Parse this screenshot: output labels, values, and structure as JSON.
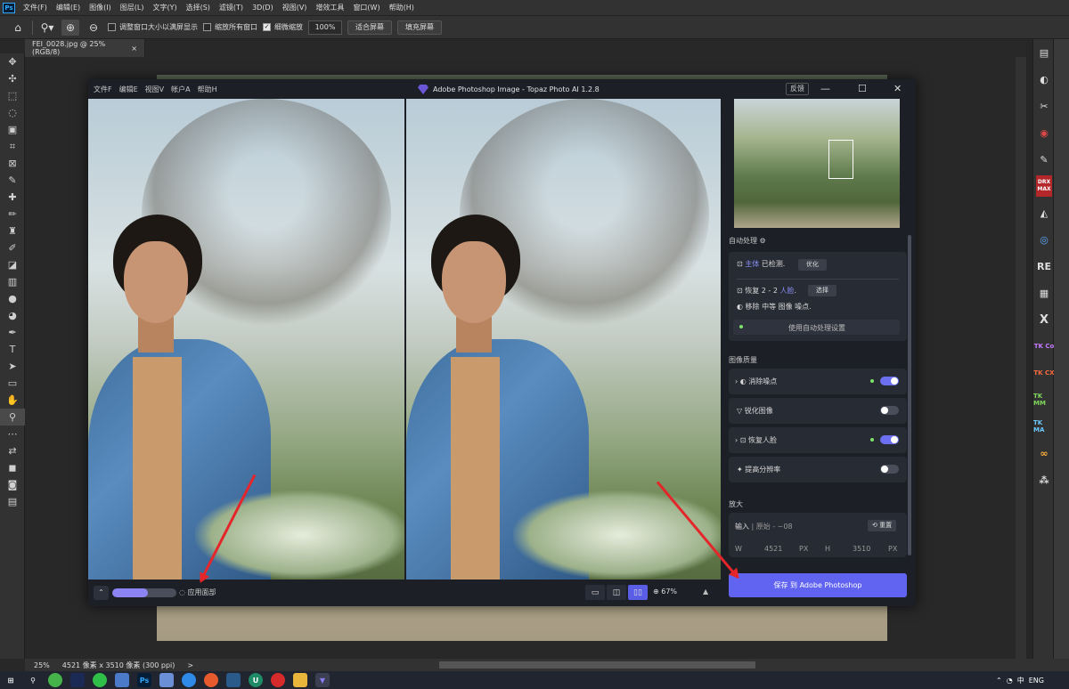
{
  "app_logo": "Ps",
  "menu": [
    "文件(F)",
    "编辑(E)",
    "图像(I)",
    "图层(L)",
    "文字(Y)",
    "选择(S)",
    "滤镜(T)",
    "3D(D)",
    "视图(V)",
    "增效工具",
    "窗口(W)",
    "帮助(H)"
  ],
  "options_bar": {
    "resize_windows": "调整窗口大小以满屏显示",
    "zoom_all_windows": "缩放所有窗口",
    "scrubby_zoom": "细微缩放",
    "zoom_value": "100%",
    "fit_screen": "适合屏幕",
    "fill_screen": "填充屏幕"
  },
  "doc_tab": {
    "title": "FEI_0028.jpg @ 25%(RGB/8)",
    "close": "×"
  },
  "status": {
    "zoom": "25%",
    "doc_info": "4521 像素 x 3510 像素 (300 ppi)",
    "arrow": ">"
  },
  "topaz": {
    "menu": [
      "文件F",
      "编辑E",
      "视图V",
      "帐户A",
      "帮助H"
    ],
    "title": "Adobe Photoshop Image - Topaz Photo AI 1.2.8",
    "feedback": "反馈",
    "apply_label": "应用面部",
    "progress_fraction": 0.55,
    "zoom_value": "67%",
    "autopilot": {
      "title": "自动处理",
      "subject_prefix": "主体",
      "subject_suffix": "已检测.",
      "subject_btn": "优化",
      "face_prefix": "恢复 2 - 2",
      "face_highlight": "人脸",
      "face_suffix": ".",
      "face_btn": "选择",
      "noise_text": "移除 中等 图像 噪点.",
      "use_settings": "使用自动处理设置"
    },
    "quality_title": "图像质量",
    "filters": [
      {
        "label": "消除噪点",
        "on": true
      },
      {
        "label": "锐化图像",
        "on": false
      },
      {
        "label": "恢复人脸",
        "on": true
      },
      {
        "label": "提高分辨率",
        "on": false
      }
    ],
    "enlarge": {
      "title": "放大",
      "input_label": "输入",
      "input_sub": "| 原始 - ~08",
      "reset_btn": "重置",
      "w_label": "W",
      "w_value": "4521",
      "w_unit": "PX",
      "h_label": "H",
      "h_value": "3510",
      "h_unit": "PX"
    },
    "save_label": "保存 到 Adobe Photoshop"
  },
  "plugin_panel_labels": [
    "DRX MAX",
    "RE",
    "X",
    "TK Co",
    "TK CX",
    "TK MM",
    "TK MA"
  ],
  "tray": {
    "lang": "中",
    "ime": "ENG"
  },
  "colors": {
    "accent": "#6164f0",
    "toggle_on": "#6b6ff0",
    "green_dot": "#7ee36a",
    "ps_bg": "#282828",
    "annotation_arrow": "#e4262a"
  }
}
